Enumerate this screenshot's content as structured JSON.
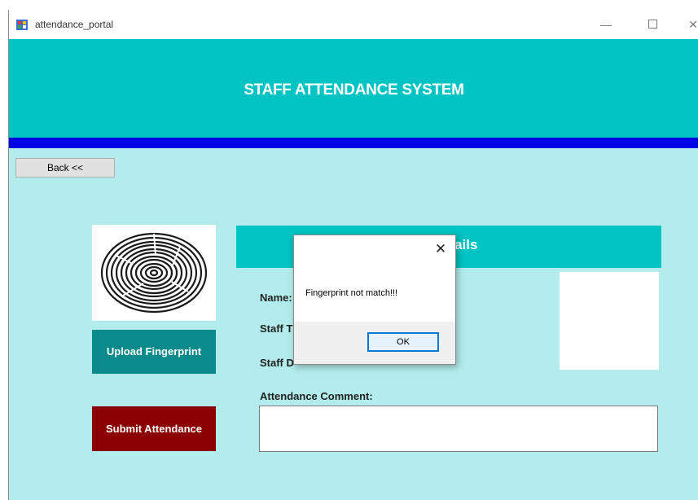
{
  "window": {
    "title": "attendance_portal",
    "controls": {
      "minimize": "—",
      "close": "✕"
    }
  },
  "header": {
    "title": "STAFF ATTENDANCE SYSTEM"
  },
  "nav": {
    "back_label": "Back <<"
  },
  "actions": {
    "upload_label": "Upload Fingerprint",
    "submit_label": "Submit Attendance"
  },
  "details": {
    "title_visible": "n Details",
    "fields": {
      "name": "Name:",
      "type": "Staff T",
      "dept": "Staff D",
      "comment": "Attendance Comment:"
    },
    "comment_value": ""
  },
  "dialog": {
    "close": "✕",
    "message": "Fingerprint not match!!!",
    "ok_label": "OK"
  },
  "colors": {
    "header_bg": "#00c3c3",
    "accent_bar": "#0000e6",
    "body_bg": "#b3ecec",
    "upload_bg": "#0a8a8a",
    "submit_bg": "#8b0000"
  }
}
